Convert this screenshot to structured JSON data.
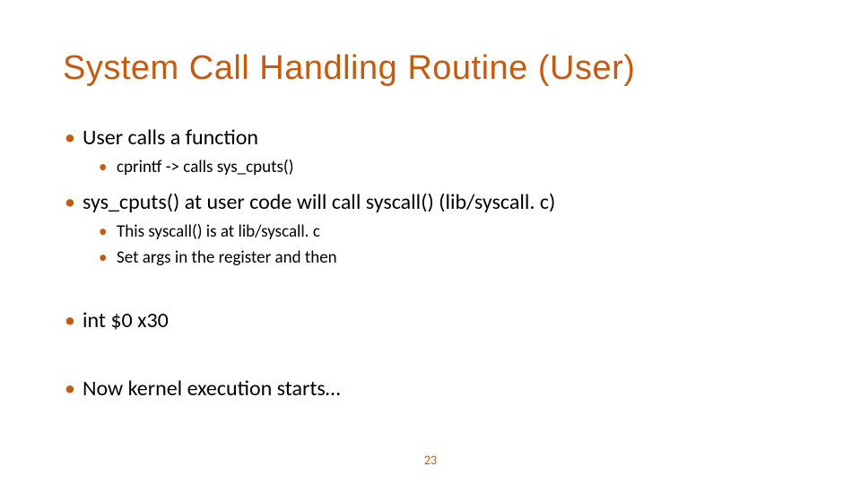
{
  "slide": {
    "title": "System Call Handling Routine (User)",
    "bullets": {
      "l1_1": "User calls a function",
      "l2_1": "cprintf -> calls sys_cputs()",
      "l1_2": "sys_cputs() at user code will call syscall() (lib/syscall. c)",
      "l2_2": "This syscall() is at lib/syscall. c",
      "l2_3": "Set args in the register and then",
      "l1_3": "int $0 x30",
      "l1_4": "Now kernel execution starts…"
    },
    "page_number": "23"
  }
}
